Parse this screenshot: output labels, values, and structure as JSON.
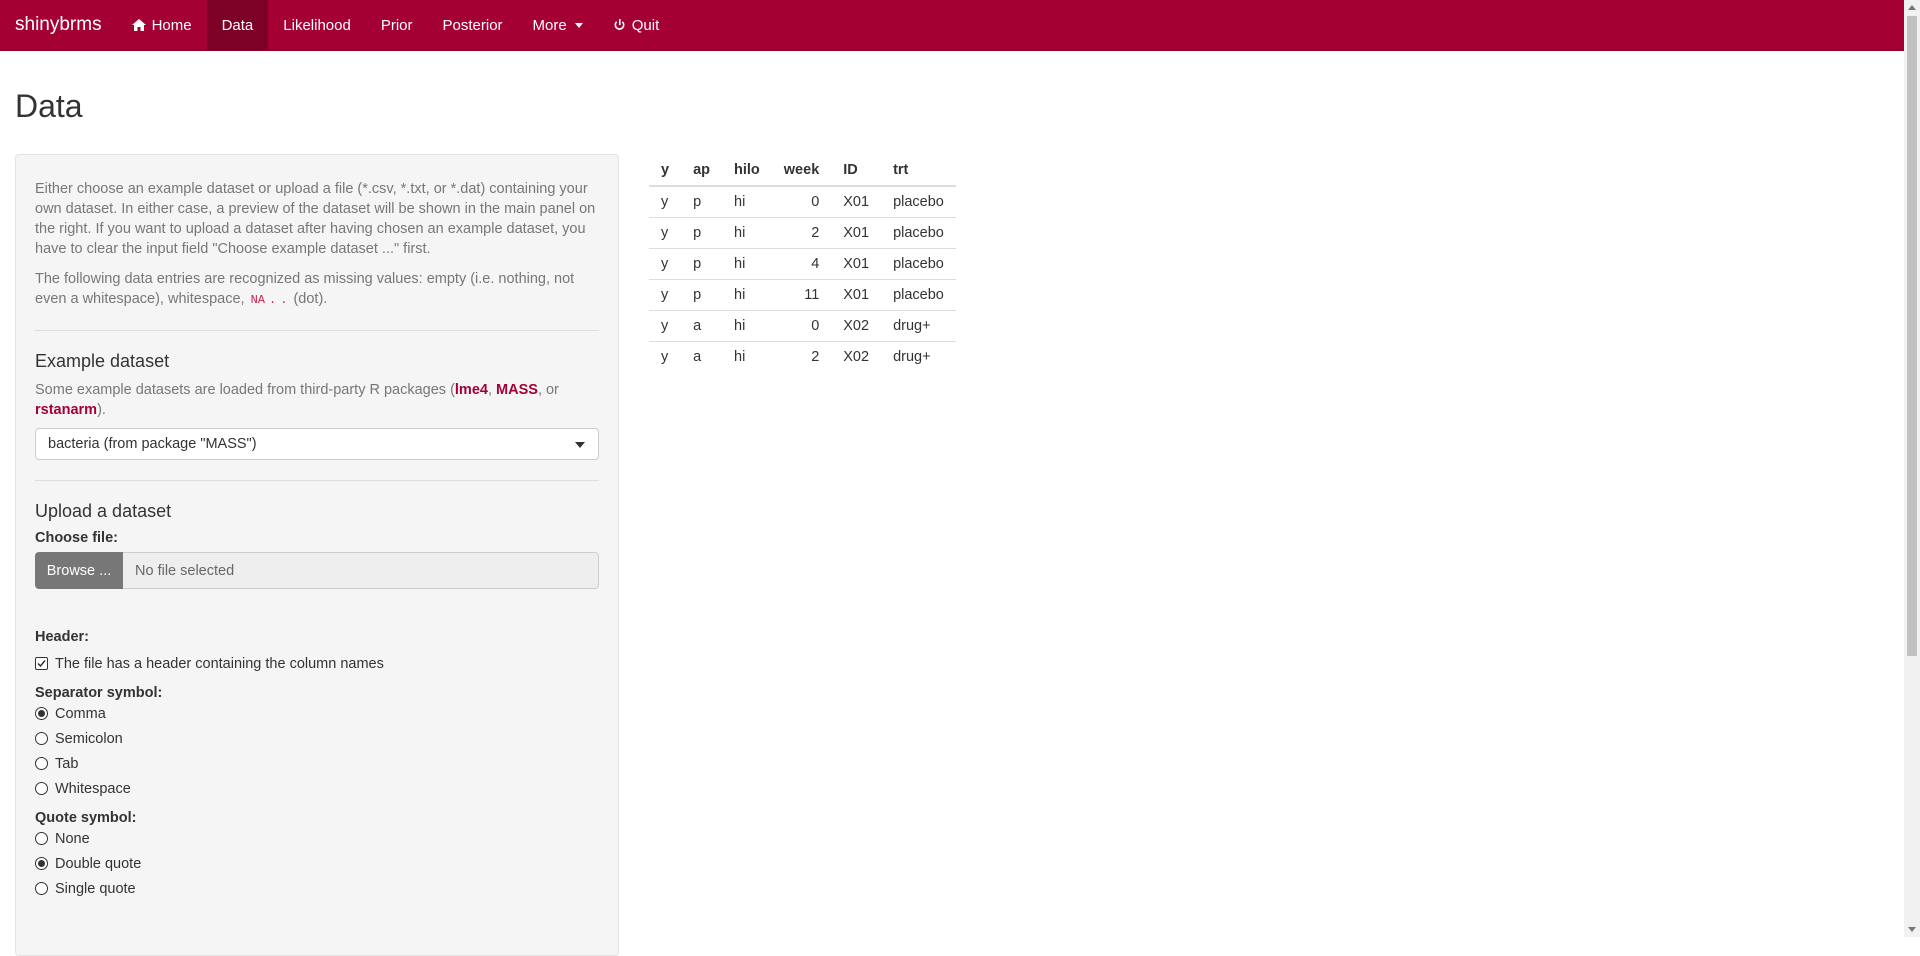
{
  "navbar": {
    "brand": "shinybrms",
    "items": [
      {
        "label": "Home",
        "icon": "home-icon"
      },
      {
        "label": "Data",
        "active": true
      },
      {
        "label": "Likelihood"
      },
      {
        "label": "Prior"
      },
      {
        "label": "Posterior"
      },
      {
        "label": "More",
        "dropdown": true
      },
      {
        "label": "Quit",
        "icon": "power-icon"
      }
    ]
  },
  "page": {
    "title": "Data"
  },
  "sidebar": {
    "intro": "Either choose an example dataset or upload a file (*.csv, *.txt, or *.dat) containing your own dataset. In either case, a preview of the dataset will be shown in the main panel on the right. If you want to upload a dataset after having chosen an example dataset, you have to clear the input field \"Choose example dataset ...\" first.",
    "missing_prefix": "The following data entries are recognized as missing values: empty (i.e. nothing, not even a whitespace), whitespace,",
    "missing_codes": [
      "NA",
      ".",
      "."
    ],
    "missing_suffix": "(dot).",
    "example": {
      "heading": "Example dataset",
      "note_prefix": "Some example datasets are loaded from third-party R packages (",
      "packages": [
        "lme4",
        "MASS",
        "rstanarm"
      ],
      "note_sep1": ", ",
      "note_sep2": ", or ",
      "note_suffix": ").",
      "selected": "bacteria (from package \"MASS\")"
    },
    "upload": {
      "heading": "Upload a dataset",
      "file_label": "Choose file:",
      "browse_label": "Browse ...",
      "file_placeholder": "No file selected",
      "header_label": "Header:",
      "header_checkbox": "The file has a header containing the column names",
      "header_checked": true,
      "separator_label": "Separator symbol:",
      "separators": [
        "Comma",
        "Semicolon",
        "Tab",
        "Whitespace"
      ],
      "separator_selected": "Comma",
      "quote_label": "Quote symbol:",
      "quotes": [
        "None",
        "Double quote",
        "Single quote"
      ],
      "quote_selected": "Double quote"
    }
  },
  "table": {
    "columns": [
      "y",
      "ap",
      "hilo",
      "week",
      "ID",
      "trt"
    ],
    "rows": [
      [
        "y",
        "p",
        "hi",
        "0",
        "X01",
        "placebo"
      ],
      [
        "y",
        "p",
        "hi",
        "2",
        "X01",
        "placebo"
      ],
      [
        "y",
        "p",
        "hi",
        "4",
        "X01",
        "placebo"
      ],
      [
        "y",
        "p",
        "hi",
        "11",
        "X01",
        "placebo"
      ],
      [
        "y",
        "a",
        "hi",
        "0",
        "X02",
        "drug+"
      ],
      [
        "y",
        "a",
        "hi",
        "2",
        "X02",
        "drug+"
      ]
    ]
  },
  "colors": {
    "brand": "#a50034",
    "active": "#7d0027"
  }
}
